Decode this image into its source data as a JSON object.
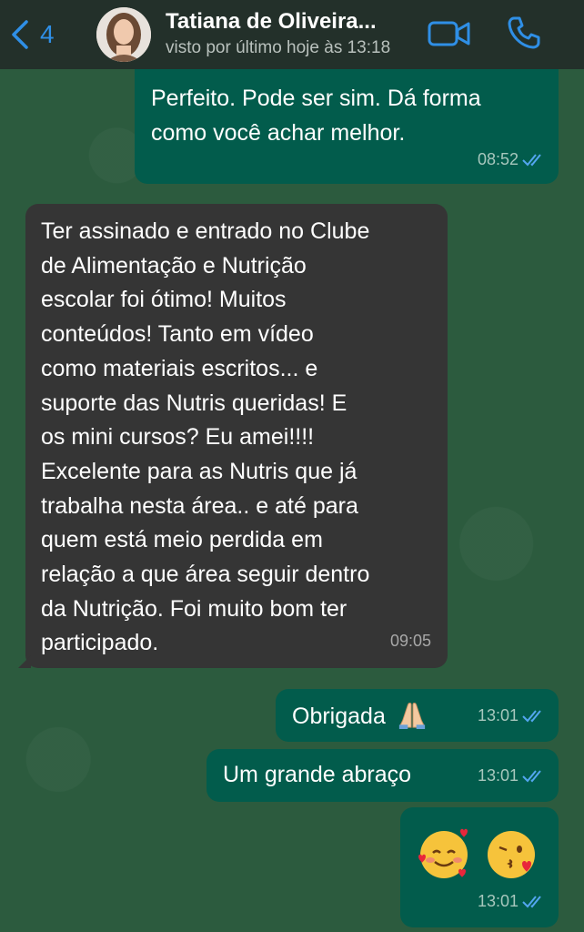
{
  "header": {
    "back_count": "4",
    "contact_name": "Tatiana de Oliveira...",
    "status": "visto por último hoje às 13:18"
  },
  "messages": [
    {
      "direction": "out",
      "text": "Perfeito. Pode ser sim. Dá forma\ncomo você achar melhor.",
      "time": "08:52",
      "read": true
    },
    {
      "direction": "in",
      "text": "Ter assinado e entrado no Clube\nde Alimentação e Nutrição\nescolar foi ótimo! Muitos\nconteúdos! Tanto em vídeo\ncomo materiais escritos... e\nsuporte das Nutris queridas! E\nos mini cursos? Eu amei!!!!\nExcelente para as Nutris que já\ntrabalha nesta área..  e até para\nquem  está  meio perdida em\nrelação a que área seguir dentro\nda Nutrição. Foi muito bom ter\nparticipado.",
      "time": "09:05"
    },
    {
      "direction": "out",
      "text": "Obrigada",
      "emoji": "praying-hands",
      "time": "13:01",
      "read": true
    },
    {
      "direction": "out",
      "text": "Um grande abraço",
      "time": "13:01",
      "read": true
    },
    {
      "direction": "out",
      "emojis": [
        "smiling-face-with-hearts",
        "face-blowing-a-kiss"
      ],
      "time": "13:01",
      "read": true
    }
  ],
  "colors": {
    "header_bg": "#23302a",
    "wallpaper": "#2c5b3e",
    "outgoing_bubble": "#025c4c",
    "incoming_bubble": "#353535",
    "accent_blue": "#2f8fe6",
    "read_ticks": "#53a6f0"
  },
  "icons": {
    "back": "chevron-left-icon",
    "video_call": "video-camera-icon",
    "voice_call": "phone-icon",
    "read_receipt": "double-check-icon"
  }
}
